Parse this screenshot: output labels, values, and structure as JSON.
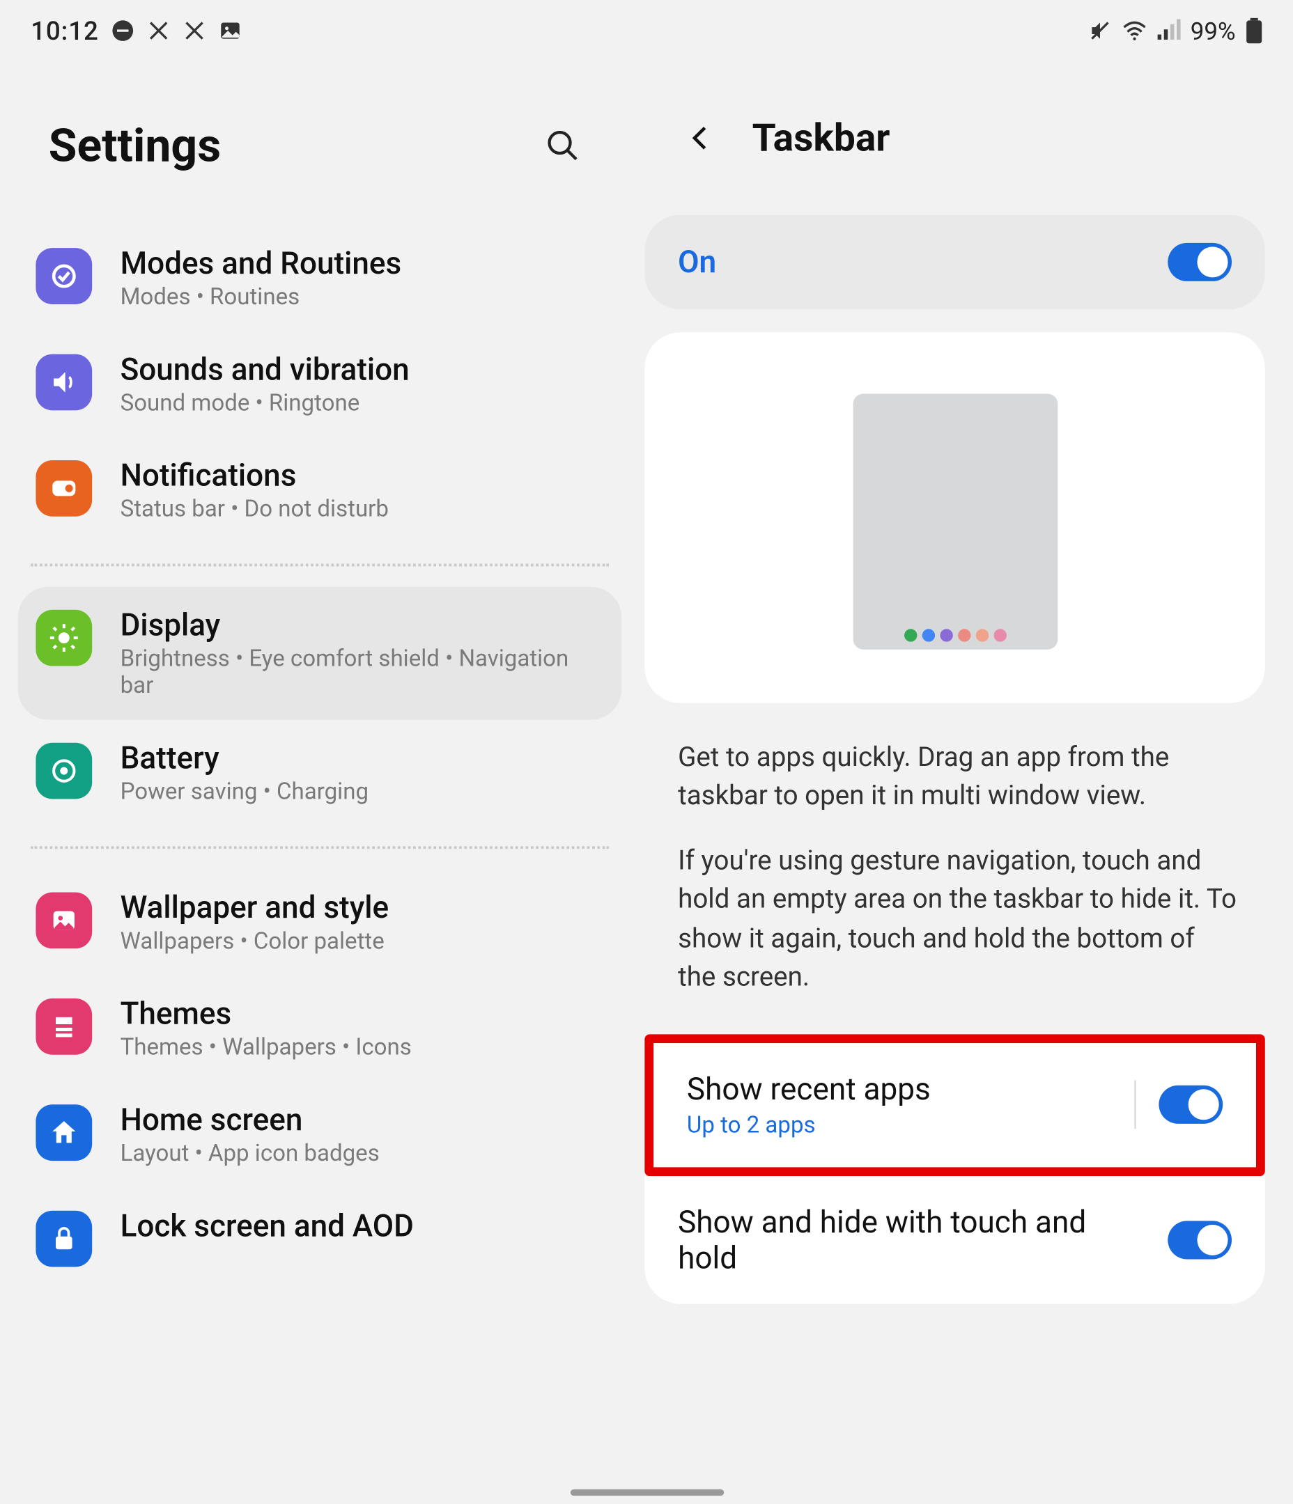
{
  "statusbar": {
    "time": "10:12",
    "battery_pct": "99%"
  },
  "left": {
    "title": "Settings",
    "items": [
      {
        "key": "modes",
        "title": "Modes and Routines",
        "sub": "Modes  •  Routines",
        "color": "#6b65e0",
        "icon": "modes"
      },
      {
        "key": "sounds",
        "title": "Sounds and vibration",
        "sub": "Sound mode  •  Ringtone",
        "color": "#6b65e0",
        "icon": "sound"
      },
      {
        "key": "notif",
        "title": "Notifications",
        "sub": "Status bar  •  Do not disturb",
        "color": "#e8631f",
        "icon": "notif"
      },
      {
        "key": "display",
        "title": "Display",
        "sub": "Brightness  •  Eye comfort shield  •  Navigation bar",
        "color": "#6bbf28",
        "icon": "sun",
        "selected": true
      },
      {
        "key": "battery",
        "title": "Battery",
        "sub": "Power saving  •  Charging",
        "color": "#11a084",
        "icon": "battery"
      },
      {
        "key": "wallpaper",
        "title": "Wallpaper and style",
        "sub": "Wallpapers  •  Color palette",
        "color": "#e23a6e",
        "icon": "image"
      },
      {
        "key": "themes",
        "title": "Themes",
        "sub": "Themes  •  Wallpapers  •  Icons",
        "color": "#e23a6e",
        "icon": "theme"
      },
      {
        "key": "home",
        "title": "Home screen",
        "sub": "Layout  •  App icon badges",
        "color": "#1a6adf",
        "icon": "home"
      },
      {
        "key": "lock",
        "title": "Lock screen and AOD",
        "sub": "",
        "color": "#1a6adf",
        "icon": "lock"
      }
    ]
  },
  "right": {
    "title": "Taskbar",
    "master": {
      "label": "On",
      "on": true
    },
    "desc1": "Get to apps quickly. Drag an app from the taskbar to open it in multi window view.",
    "desc2": "If you're using gesture navigation, touch and hold an empty area on the taskbar to hide it. To show it again, touch and hold the bottom of the screen.",
    "settings": [
      {
        "key": "recent",
        "title": "Show recent apps",
        "sub": "Up to 2 apps",
        "on": true,
        "highlight": true,
        "sep": true
      },
      {
        "key": "touchhold",
        "title": "Show and hide with touch and hold",
        "on": true
      }
    ]
  }
}
